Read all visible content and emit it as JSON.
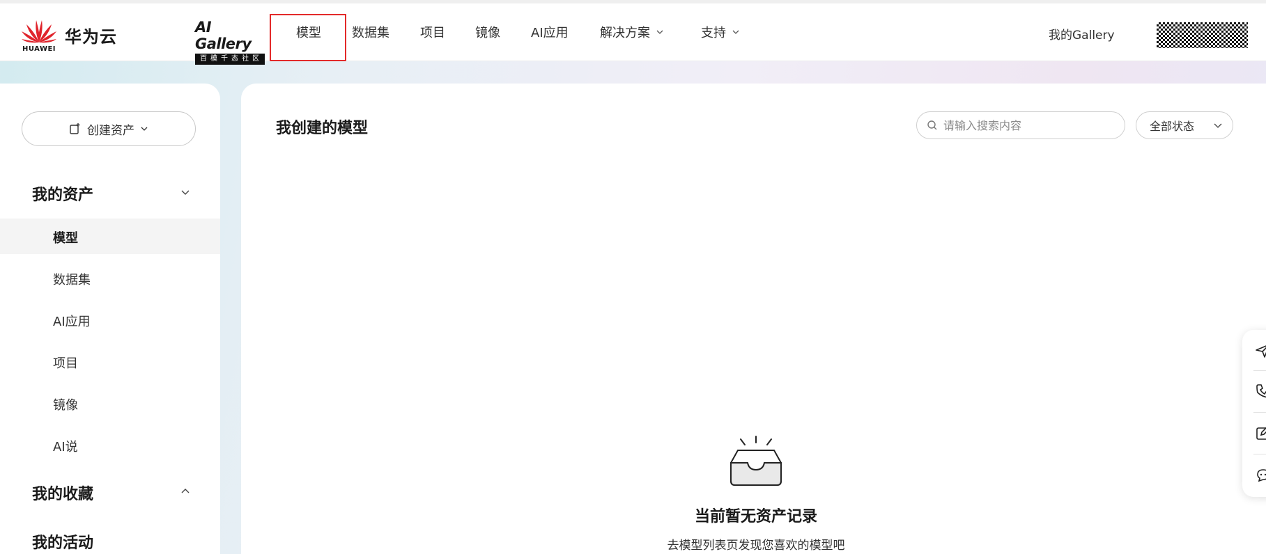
{
  "brand": {
    "company_name": "华为云",
    "logo_text": "HUAWEI",
    "gallery_title": "AI Gallery",
    "gallery_subtitle": "百模千态社区",
    "brand_red": "#e0242c"
  },
  "nav": {
    "items": [
      {
        "label": "模型",
        "has_dropdown": false
      },
      {
        "label": "数据集",
        "has_dropdown": false
      },
      {
        "label": "项目",
        "has_dropdown": false
      },
      {
        "label": "镜像",
        "has_dropdown": false
      },
      {
        "label": "AI应用",
        "has_dropdown": false
      },
      {
        "label": "解决方案",
        "has_dropdown": true
      },
      {
        "label": "支持",
        "has_dropdown": true
      }
    ],
    "highlight_color": "#e32a2a",
    "my_gallery": "我的Gallery"
  },
  "sidebar": {
    "create_button": "创建资产",
    "groups": [
      {
        "label": "我的资产",
        "expanded": true,
        "items": [
          "模型",
          "数据集",
          "AI应用",
          "项目",
          "镜像",
          "AI说"
        ],
        "active": "模型"
      },
      {
        "label": "我的收藏",
        "expanded": false
      },
      {
        "label": "我的活动"
      }
    ]
  },
  "main": {
    "title": "我创建的模型",
    "search_placeholder": "请输入搜索内容",
    "status_filter": "全部状态",
    "empty_title": "当前暂无资产记录",
    "empty_subtitle": "去模型列表页发现您喜欢的模型吧"
  },
  "float_toolbar": {
    "icons": [
      "send-icon",
      "phone-icon",
      "edit-icon",
      "chat-icon"
    ]
  }
}
